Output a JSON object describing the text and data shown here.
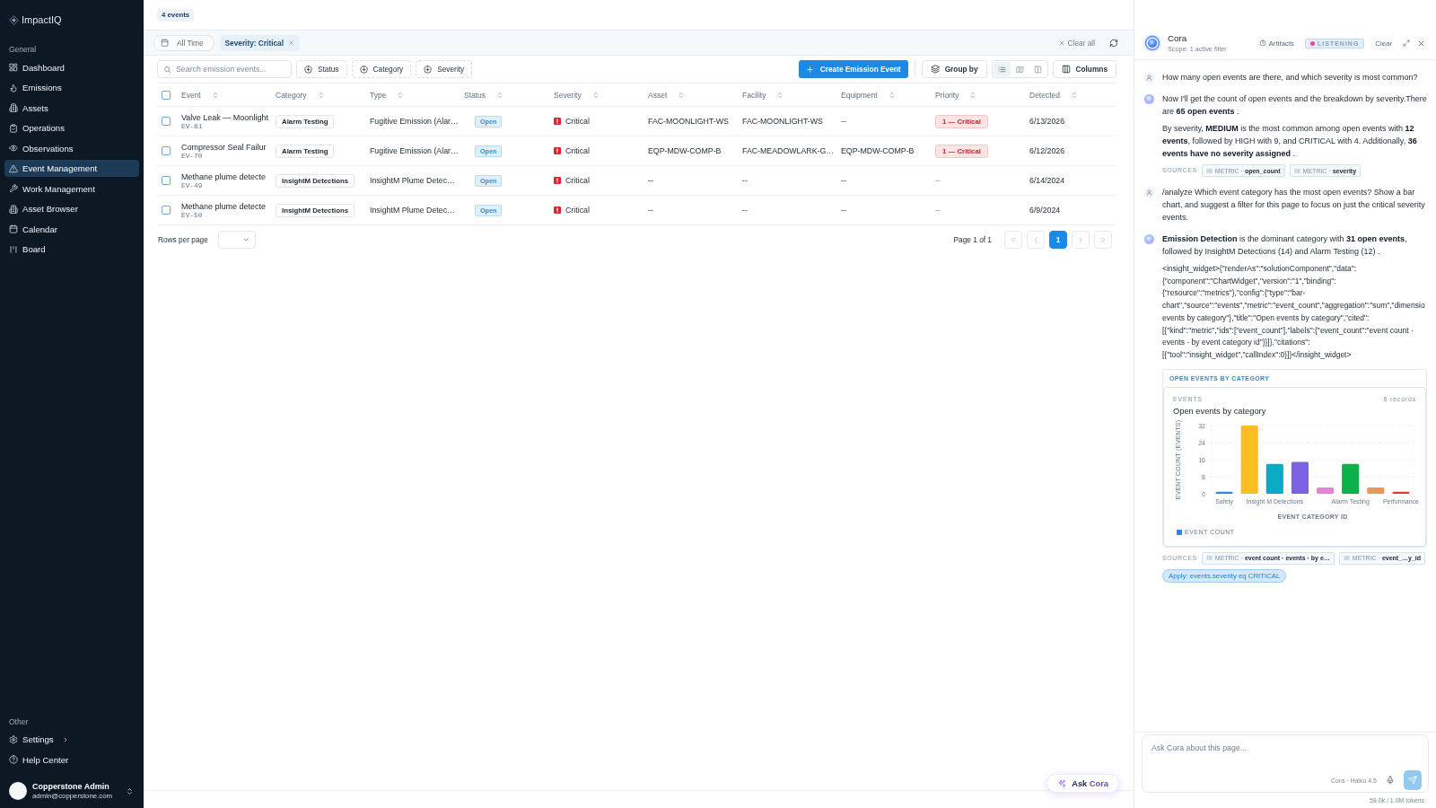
{
  "sidebar": {
    "brand": "ImpactIQ",
    "sections": [
      {
        "title": "General",
        "items": [
          {
            "label": "Dashboard",
            "selected": false,
            "submenu": false
          },
          {
            "label": "Emissions",
            "selected": false,
            "submenu": false
          },
          {
            "label": "Assets",
            "selected": false,
            "submenu": false
          },
          {
            "label": "Operations",
            "selected": false,
            "submenu": false
          },
          {
            "label": "Observations",
            "selected": false,
            "submenu": false
          },
          {
            "label": "Event Management",
            "selected": true,
            "submenu": false
          },
          {
            "label": "Work Management",
            "selected": false,
            "submenu": false
          },
          {
            "label": "Asset Browser",
            "selected": false,
            "submenu": false
          },
          {
            "label": "Calendar",
            "selected": false,
            "submenu": false
          },
          {
            "label": "Board",
            "selected": false,
            "submenu": false
          }
        ]
      },
      {
        "title": "Other",
        "items": [
          {
            "label": "Settings",
            "selected": false,
            "submenu": true
          },
          {
            "label": "Help Center",
            "selected": false,
            "submenu": false
          }
        ]
      }
    ],
    "user": {
      "name": "Copperstone Admin",
      "email": "admin@copperstone.com"
    }
  },
  "main": {
    "count_badge": "4 events",
    "filter_bar": {
      "date_range": "All Time",
      "active_filters": [
        {
          "label": "Severity: Critical"
        }
      ],
      "clear_label": "Clear all"
    },
    "toolbar": {
      "search": {
        "placeholder": "Search emission events..."
      },
      "filter_buttons": [
        "Status",
        "Category",
        "Severity"
      ],
      "create_label": "Create Emission Event",
      "group_label": "Group by",
      "views": [
        {
          "selected": true
        },
        {
          "selected": false
        },
        {
          "selected": false
        }
      ],
      "columns_label": "Columns"
    },
    "table": {
      "all_checked": false,
      "columns": [
        "Event",
        "Category",
        "Type",
        "Status",
        "Severity",
        "Asset",
        "Facility",
        "Equipment",
        "Priority",
        "Detected"
      ],
      "rows": [
        {
          "checked": false,
          "event": "Valve Leak — Moonlight",
          "id": "EV-81",
          "category": "Alarm Testing",
          "type": "Fugitive Emission (Alar…",
          "status": "Open",
          "severity": "Critical",
          "asset": "FAC-MOONLIGHT-WS",
          "facility": "FAC-MOONLIGHT-WS",
          "equipment": "--",
          "priority": {
            "kind": "badge",
            "text": "1 — Critical"
          },
          "detected": "6/13/2026"
        },
        {
          "checked": false,
          "event": "Compressor Seal Failur",
          "id": "EV-70",
          "category": "Alarm Testing",
          "type": "Fugitive Emission (Alar…",
          "status": "Open",
          "severity": "Critical",
          "asset": "EQP-MDW-COMP-B",
          "facility": "FAC-MEADOWLARK-G…",
          "equipment": "EQP-MDW-COMP-B",
          "priority": {
            "kind": "badge",
            "text": "1 — Critical"
          },
          "detected": "6/12/2026"
        },
        {
          "checked": false,
          "event": "Methane plume detecte",
          "id": "EV-49",
          "category": "InsightM Detections",
          "type": "InsightM Plume Detec…",
          "status": "Open",
          "severity": "Critical",
          "asset": "--",
          "facility": "--",
          "equipment": "--",
          "priority": {
            "kind": "plain",
            "text": "--"
          },
          "detected": "6/14/2024"
        },
        {
          "checked": false,
          "event": "Methane plume detecte",
          "id": "EV-50",
          "category": "InsightM Detections",
          "type": "InsightM Plume Detec…",
          "status": "Open",
          "severity": "Critical",
          "asset": "--",
          "facility": "--",
          "equipment": "--",
          "priority": {
            "kind": "plain",
            "text": "--"
          },
          "detected": "6/9/2024"
        }
      ]
    },
    "pagination": {
      "rows_per_page_label": "Rows per page",
      "page_info": "Page 1 of 1",
      "nav_disabled": true,
      "pages": [
        {
          "label": "1",
          "selected": true
        }
      ]
    },
    "ask_button": {
      "label": "Ask",
      "accent": "Cora"
    }
  },
  "assistant": {
    "title": "Cora",
    "scope": "Scope: 1 active filter",
    "artifacts_label": "Artifacts",
    "status": {
      "label": "LISTENING",
      "active": true
    },
    "clear_label": "Clear",
    "messages": [
      {
        "kind": "user",
        "paragraphs": [
          "How many open events are there, and which severity is most common?"
        ]
      },
      {
        "kind": "assistant",
        "paragraphs": [
          "Now I'll get the count of open events and the breakdown by severity.There are **65 open events** .",
          "By severity, **MEDIUM** is the most common among open events with **12 events**, followed by HIGH with 9, and CRITICAL with 4. Additionally, **36 events have no severity assigned** ."
        ],
        "sources": {
          "label": "SOURCES",
          "items": [
            "METRIC · **open_count**",
            "METRIC · **severity**"
          ]
        }
      },
      {
        "kind": "user",
        "paragraphs": [
          "/analyze Which event category has the most open events? Show a bar chart, and suggest a filter for this page to focus on just the critical severity events."
        ]
      },
      {
        "kind": "assistant",
        "paragraphs": [
          "**Emission Detection** is the dominant category with **31 open events**, followed by InsightM Detections (14) and Alarm Testing (12) ."
        ],
        "raw_lines": [
          "<insight_widget>{\"renderAs\":\"solutionComponent\",\"data\":",
          "{\"component\":\"ChartWidget\",\"version\":\"1\",\"binding\":",
          "{\"resource\":\"metrics\"},\"config\":{\"type\":\"bar-",
          "chart\",\"source\":\"events\",\"metric\":\"event_count\",\"aggregation\":\"sum\",\"dimensio",
          "events by category\"},\"title\":\"Open events by category\",\"cited\":",
          "[{\"kind\":\"metric\",\"ids\":[\"event_count\"],\"labels\":{\"event_count\":\"event count ·",
          "events · by event category id\"}}]},\"citations\":",
          "[{\"tool\":\"insight_widget\",\"callIndex\":0}]}</insight_widget>"
        ],
        "widget": {
          "header": "OPEN EVENTS BY CATEGORY",
          "label": "EVENTS",
          "records": "8 records",
          "bars": [
            {
              "color": "#2f86e8"
            },
            {
              "color": "#fbbd23"
            },
            {
              "color": "#08aac4"
            },
            {
              "color": "#7c62e2"
            },
            {
              "color": "#e283d6"
            },
            {
              "color": "#0bb14a"
            },
            {
              "color": "#e9985a"
            },
            {
              "color": "#e03a3a"
            }
          ],
          "chart_data": {
            "type": "bar",
            "title": "Open events by category",
            "xlabel": "EVENT CATEGORY ID",
            "ylabel": "EVENT COUNT (EVENTS)",
            "categories": [
              "Safety",
              null,
              "Insight M Detections",
              null,
              null,
              "Alarm Testing",
              null,
              "Performance"
            ],
            "ylim": [
              0,
              32
            ],
            "yticks": [
              0,
              8,
              16,
              24,
              32
            ],
            "grid": true,
            "series": [
              {
                "name": "EVENT COUNT",
                "values": [
                  1,
                  32,
                  14,
                  15,
                  3,
                  14,
                  3,
                  1
                ]
              }
            ]
          }
        },
        "sources": {
          "label": "SOURCES",
          "items": [
            "METRIC · **event count · events · by e…**",
            "METRIC · **event_…y_id**"
          ]
        },
        "actions": [
          "Apply: events.severity eq CRITICAL"
        ]
      }
    ],
    "composer": {
      "placeholder": "Ask Cora about this page...",
      "model": "Cora · Haiku 4.5",
      "tokens": "59.0k / 1.0M tokens"
    }
  }
}
